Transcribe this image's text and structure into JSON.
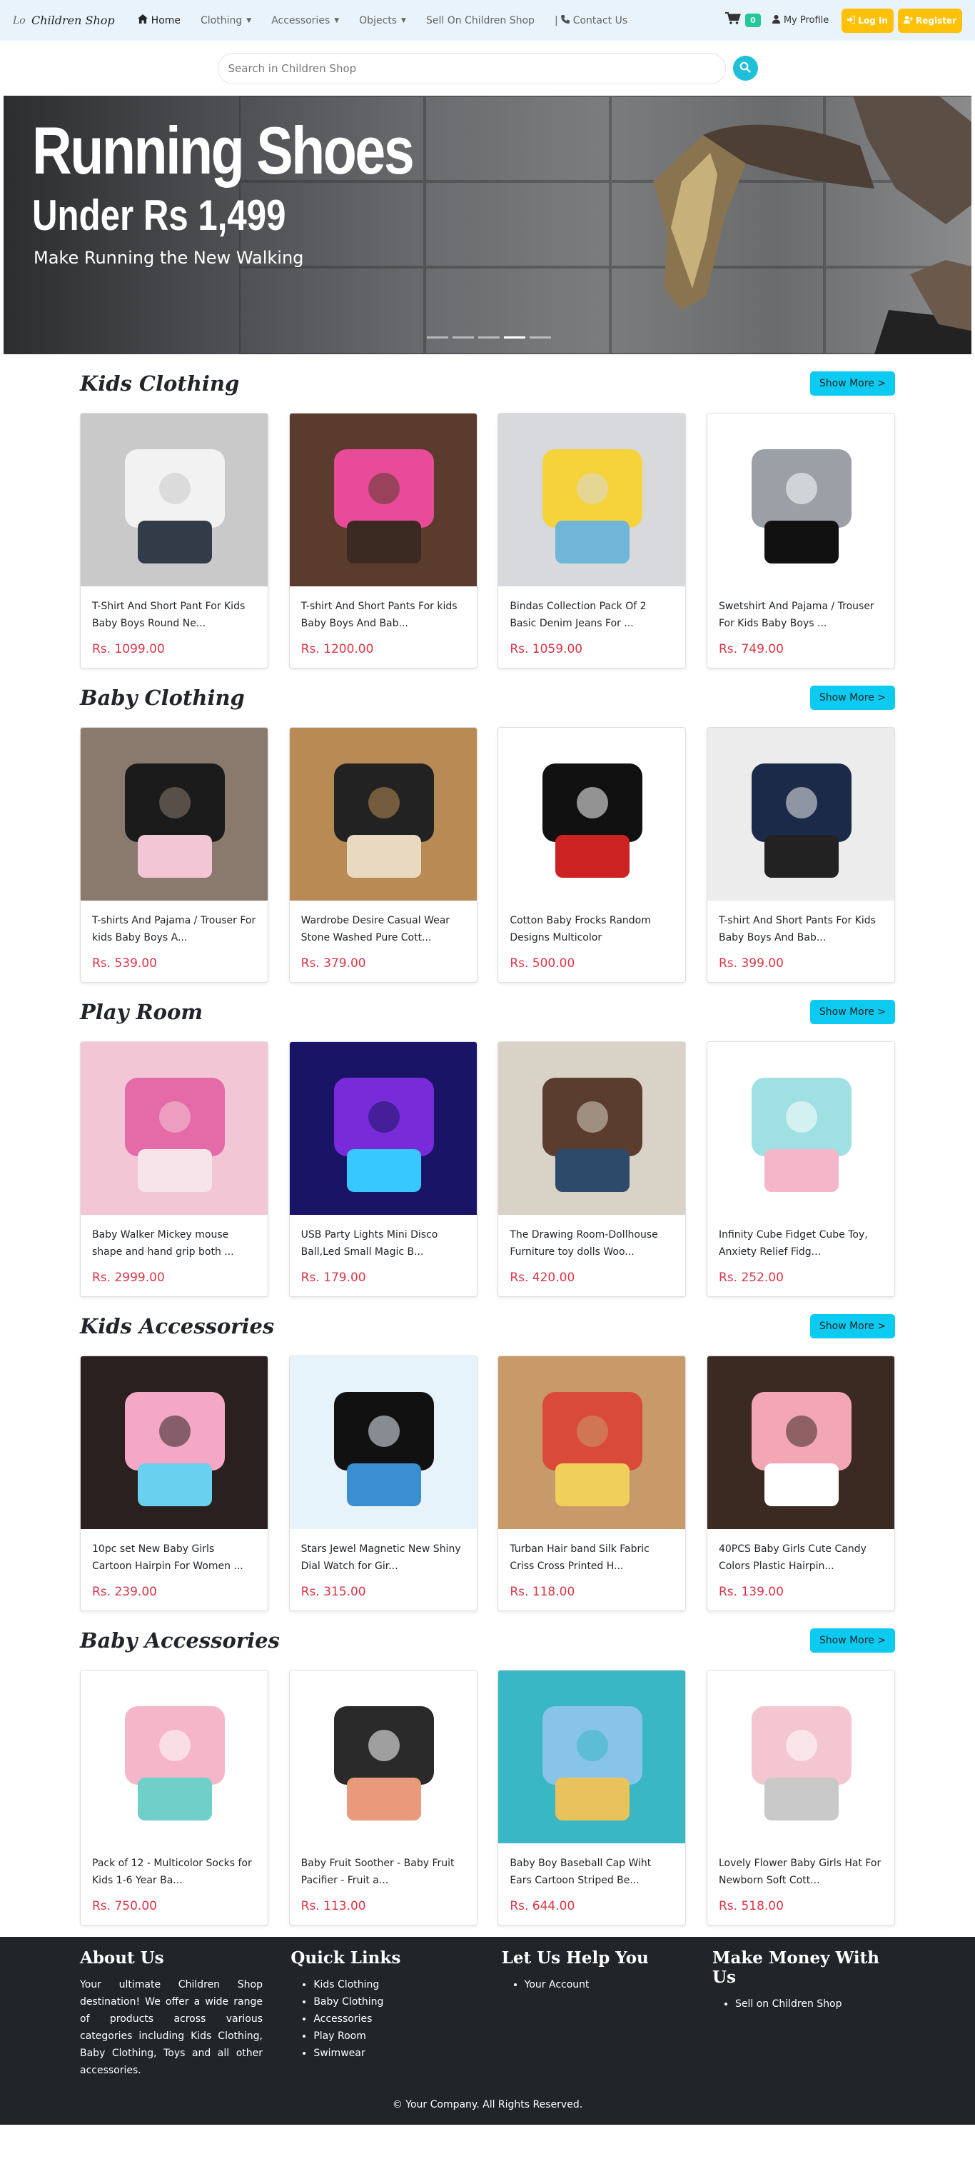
{
  "nav": {
    "logo_alt": "Lo",
    "brand": "Children Shop",
    "home": "Home",
    "clothing": "Clothing",
    "accessories": "Accessories",
    "objects": "Objects",
    "sell": "Sell On Children Shop",
    "contact": "Contact Us",
    "cart_count": "0",
    "profile": "My Profile",
    "login": "Log In",
    "register": "Register"
  },
  "search": {
    "placeholder": "Search in Children Shop"
  },
  "hero": {
    "title": "Running Shoes",
    "subtitle": "Under Rs 1,499",
    "tagline": "Make Running the New Walking",
    "slides": 5,
    "active_slide": 4
  },
  "show_more": "Show More >",
  "sections": [
    {
      "title": "Kids Clothing",
      "products": [
        {
          "name": "T-Shirt And Short Pant For Kids Baby Boys Round Ne...",
          "price": "Rs. 1099.00"
        },
        {
          "name": "T-shirt And Short Pants For kids Baby Boys And Bab...",
          "price": "Rs. 1200.00"
        },
        {
          "name": "Bindas Collection Pack Of 2 Basic Denim Jeans For ...",
          "price": "Rs. 1059.00"
        },
        {
          "name": "Swetshirt And Pajama / Trouser For Kids Baby Boys ...",
          "price": "Rs. 749.00"
        }
      ]
    },
    {
      "title": "Baby Clothing",
      "products": [
        {
          "name": "T-shirts And Pajama / Trouser For kids Baby Boys A...",
          "price": "Rs. 539.00"
        },
        {
          "name": "Wardrobe Desire Casual Wear Stone Washed Pure Cott...",
          "price": "Rs. 379.00"
        },
        {
          "name": "Cotton Baby Frocks Random Designs Multicolor",
          "price": "Rs. 500.00"
        },
        {
          "name": "T-shirt And Short Pants For Kids Baby Boys And Bab...",
          "price": "Rs. 399.00"
        }
      ]
    },
    {
      "title": "Play Room",
      "products": [
        {
          "name": "Baby Walker Mickey mouse shape and hand grip both ...",
          "price": "Rs. 2999.00"
        },
        {
          "name": "USB Party Lights Mini Disco Ball,Led Small Magic B...",
          "price": "Rs. 179.00"
        },
        {
          "name": "The Drawing Room-Dollhouse Furniture toy dolls Woo...",
          "price": "Rs. 420.00"
        },
        {
          "name": "Infinity Cube Fidget Cube Toy, Anxiety Relief Fidg...",
          "price": "Rs. 252.00"
        }
      ]
    },
    {
      "title": "Kids Accessories",
      "products": [
        {
          "name": "10pc set New Baby Girls Cartoon Hairpin For Women ...",
          "price": "Rs. 239.00"
        },
        {
          "name": "Stars Jewel Magnetic New Shiny Dial Watch for Gir...",
          "price": "Rs. 315.00"
        },
        {
          "name": "Turban Hair band Silk Fabric Criss Cross Printed H...",
          "price": "Rs. 118.00"
        },
        {
          "name": "40PCS Baby Girls Cute Candy Colors Plastic Hairpin...",
          "price": "Rs. 139.00"
        }
      ]
    },
    {
      "title": "Baby Accessories",
      "products": [
        {
          "name": "Pack of 12 - Multicolor Socks for Kids 1-6 Year Ba...",
          "price": "Rs. 750.00"
        },
        {
          "name": "Baby Fruit Soother - Baby Fruit Pacifier - Fruit a...",
          "price": "Rs. 113.00"
        },
        {
          "name": "Baby Boy Baseball Cap Wiht Ears Cartoon Striped Be...",
          "price": "Rs. 644.00"
        },
        {
          "name": "Lovely Flower Baby Girls Hat For Newborn Soft Cott...",
          "price": "Rs. 518.00"
        }
      ]
    }
  ],
  "footer": {
    "about_title": "About Us",
    "about_text": "Your ultimate Children Shop destination! We offer a wide range of products across various categories including Kids Clothing, Baby Clothing, Toys and all other accessories.",
    "quick_title": "Quick Links",
    "quick_links": [
      "Kids Clothing",
      "Baby Clothing",
      "Accessories",
      "Play Room",
      "Swimwear"
    ],
    "help_title": "Let Us Help You",
    "help_links": [
      "Your Account"
    ],
    "money_title": "Make Money With Us",
    "money_links": [
      "Sell on Children Shop"
    ],
    "copyright": "© Your Company. All Rights Reserved."
  }
}
